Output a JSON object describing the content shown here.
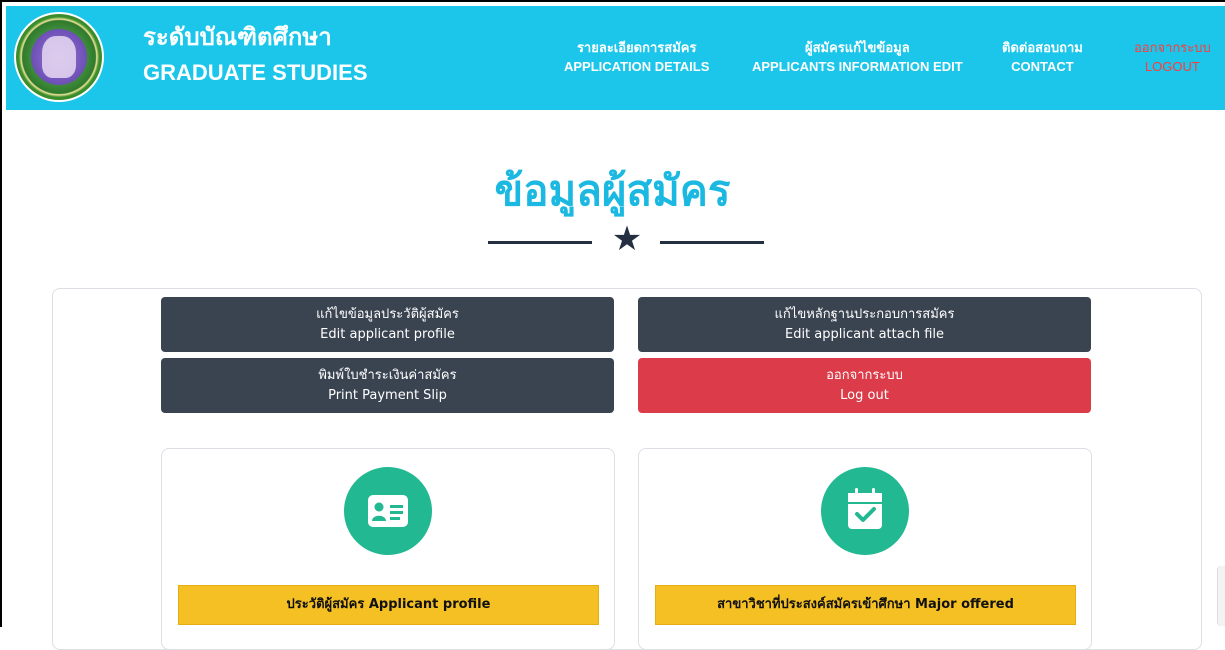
{
  "header": {
    "brand_th": "ระดับบัณฑิตศึกษา",
    "brand_en": "GRADUATE STUDIES",
    "nav": [
      {
        "th": "รายละเอียดการสมัคร",
        "en": "APPLICATION DETAILS"
      },
      {
        "th": "ผู้สมัครแก้ไขข้อมูล",
        "en": "APPLICANTS INFORMATION EDIT"
      },
      {
        "th": "ติดต่อสอบถาม",
        "en": "CONTACT"
      },
      {
        "th": "ออกจากระบบ",
        "en": "LOGOUT"
      }
    ],
    "bg_color": "#1bc6ea",
    "logout_color": "#ff3b3b"
  },
  "page": {
    "title": "ข้อมูลผู้สมัคร"
  },
  "actions": [
    {
      "th": "แก้ไขข้อมูลประวัติผู้สมัคร",
      "en": "Edit applicant profile"
    },
    {
      "th": "แก้ไขหลักฐานประกอบการสมัคร",
      "en": "Edit applicant attach file"
    },
    {
      "th": "พิมพ์ใบชำระเงินค่าสมัคร",
      "en": "Print Payment Slip"
    },
    {
      "th": "ออกจากระบบ",
      "en": "Log out"
    }
  ],
  "cards": [
    {
      "icon": "id-card-icon",
      "title": "ประวัติผู้สมัคร Applicant profile"
    },
    {
      "icon": "calendar-check-icon",
      "title": "สาขาวิชาที่ประสงค์สมัครเข้าศึกษา Major offered"
    }
  ],
  "colors": {
    "title": "#1bb8e1",
    "dark_button": "#3a4350",
    "red_button": "#dc3b49",
    "icon_circle": "#22b892",
    "card_header": "#f5c024"
  }
}
